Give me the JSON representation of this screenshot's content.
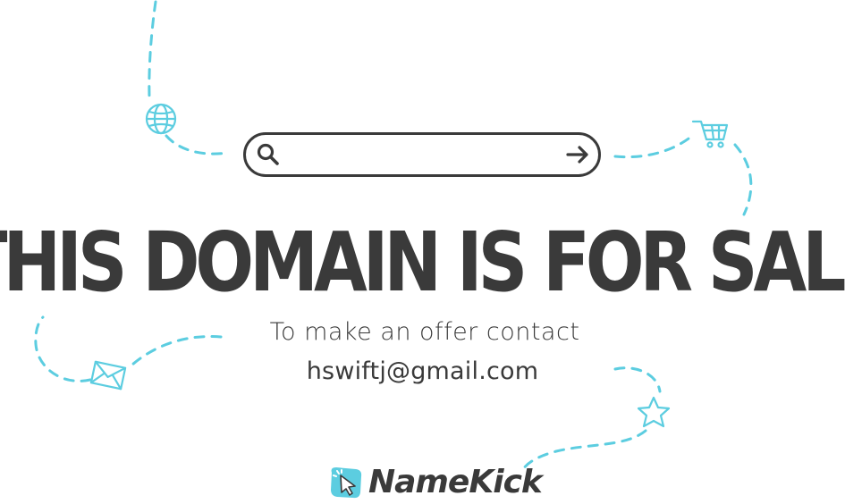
{
  "colors": {
    "accent": "#5ccde0",
    "text": "#3a3a3a",
    "background": "#ffffff"
  },
  "search": {
    "value": "",
    "placeholder": ""
  },
  "headline": "THIS DOMAIN IS FOR SALE",
  "offer": {
    "line": "To make an offer contact",
    "email": "hswiftj@gmail.com"
  },
  "brand": {
    "name": "NameKick",
    "icon": "cursor-click-icon"
  },
  "decorations": [
    "globe-icon",
    "shopping-cart-icon",
    "envelope-icon",
    "star-icon"
  ]
}
